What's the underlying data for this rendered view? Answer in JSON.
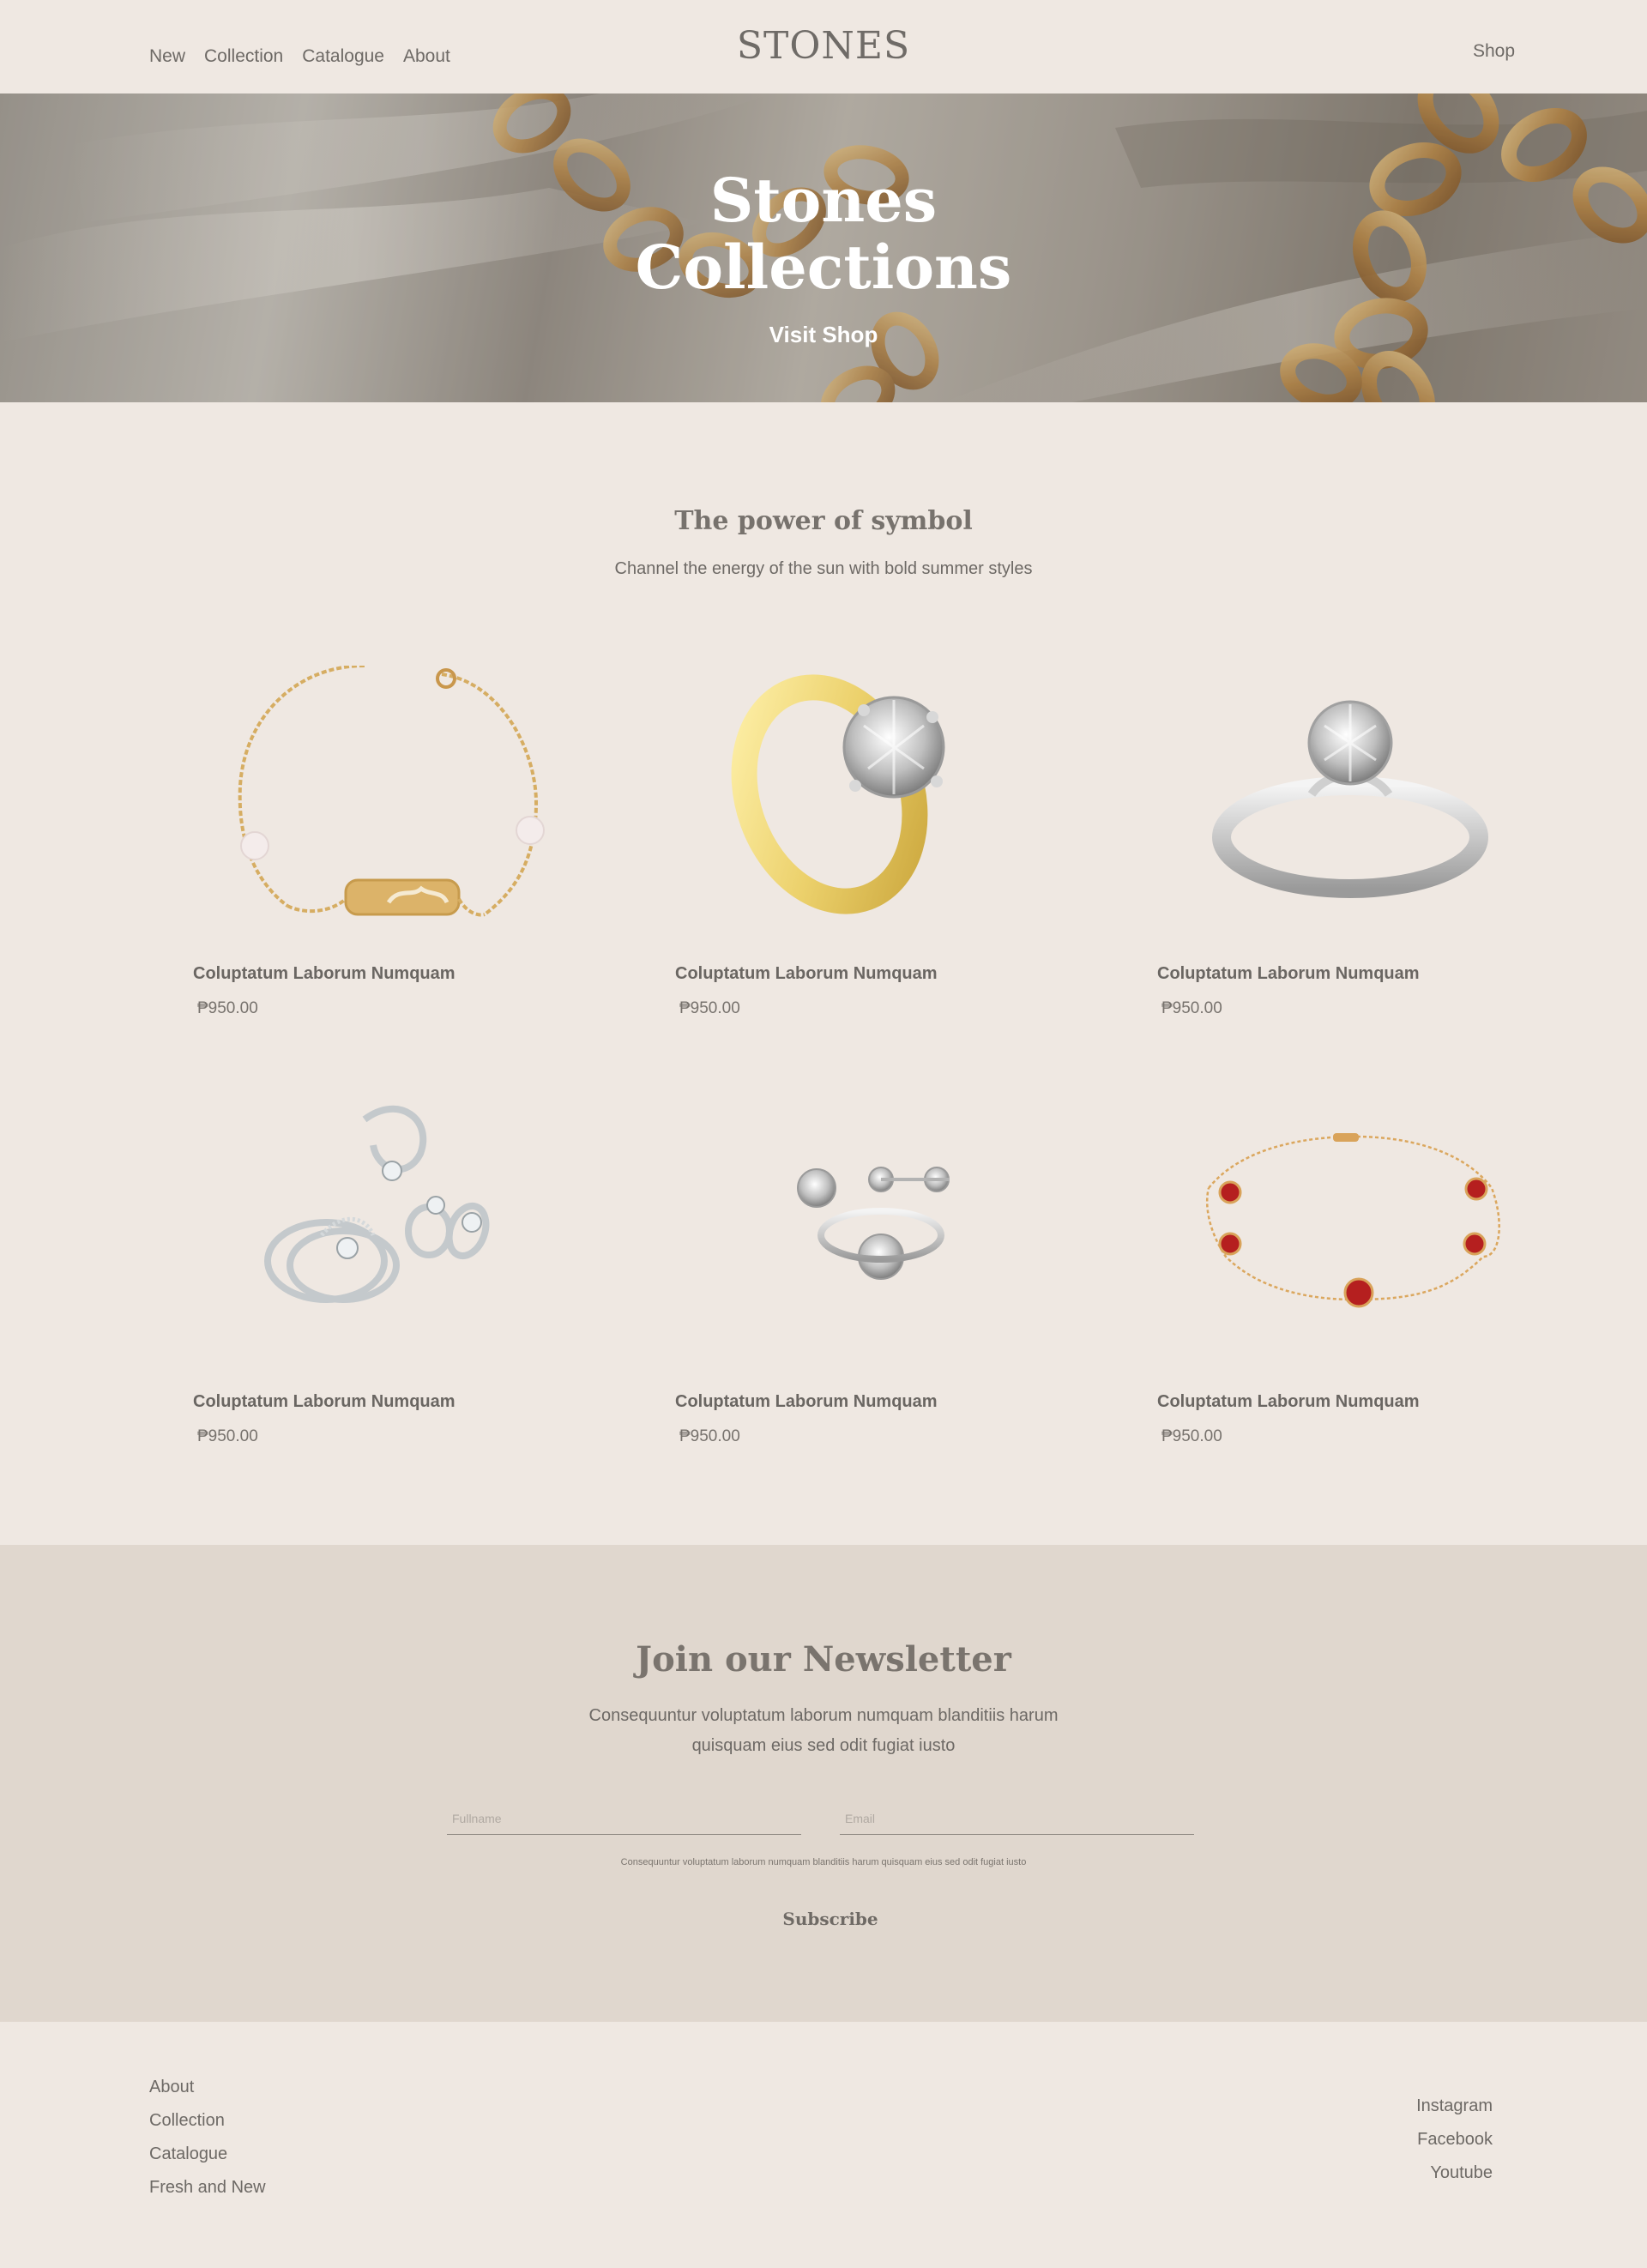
{
  "header": {
    "nav": [
      "New",
      "Collection",
      "Catalogue",
      "About"
    ],
    "logo": "STONES",
    "shop": "Shop"
  },
  "hero": {
    "title_line1": "Stones",
    "title_line2": "Collections",
    "cta": "Visit Shop"
  },
  "intro": {
    "title": "The power of symbol",
    "subtitle": "Channel the energy of the sun with bold summer styles"
  },
  "products": [
    {
      "name": "Coluptatum Laborum Numquam",
      "price": "₱950.00",
      "image": "gold-bracelet-pearls"
    },
    {
      "name": "Coluptatum Laborum Numquam",
      "price": "₱950.00",
      "image": "gold-diamond-ring"
    },
    {
      "name": "Coluptatum Laborum Numquam",
      "price": "₱950.00",
      "image": "silver-diamond-ring"
    },
    {
      "name": "Coluptatum Laborum Numquam",
      "price": "₱950.00",
      "image": "silver-jewelry-set"
    },
    {
      "name": "Coluptatum Laborum Numquam",
      "price": "₱950.00",
      "image": "diamond-earrings-ring-set"
    },
    {
      "name": "Coluptatum Laborum Numquam",
      "price": "₱950.00",
      "image": "red-clover-bracelet"
    }
  ],
  "newsletter": {
    "title": "Join our Newsletter",
    "text_line1": "Consequuntur voluptatum laborum numquam blanditiis harum",
    "text_line2": "quisquam eius sed odit fugiat iusto",
    "fullname_placeholder": "Fullname",
    "email_placeholder": "Email",
    "small_text": "Consequuntur voluptatum laborum numquam blanditiis harum quisquam eius sed odit fugiat iusto",
    "subscribe": "Subscribe"
  },
  "footer": {
    "links": [
      "About",
      "Collection",
      "Catalogue",
      "Fresh and New"
    ],
    "social": [
      "Instagram",
      "Facebook",
      "Youtube"
    ]
  },
  "colors": {
    "background": "#efe8e2",
    "newsletter_bg": "#e0d7ce",
    "text": "#6d6965"
  }
}
